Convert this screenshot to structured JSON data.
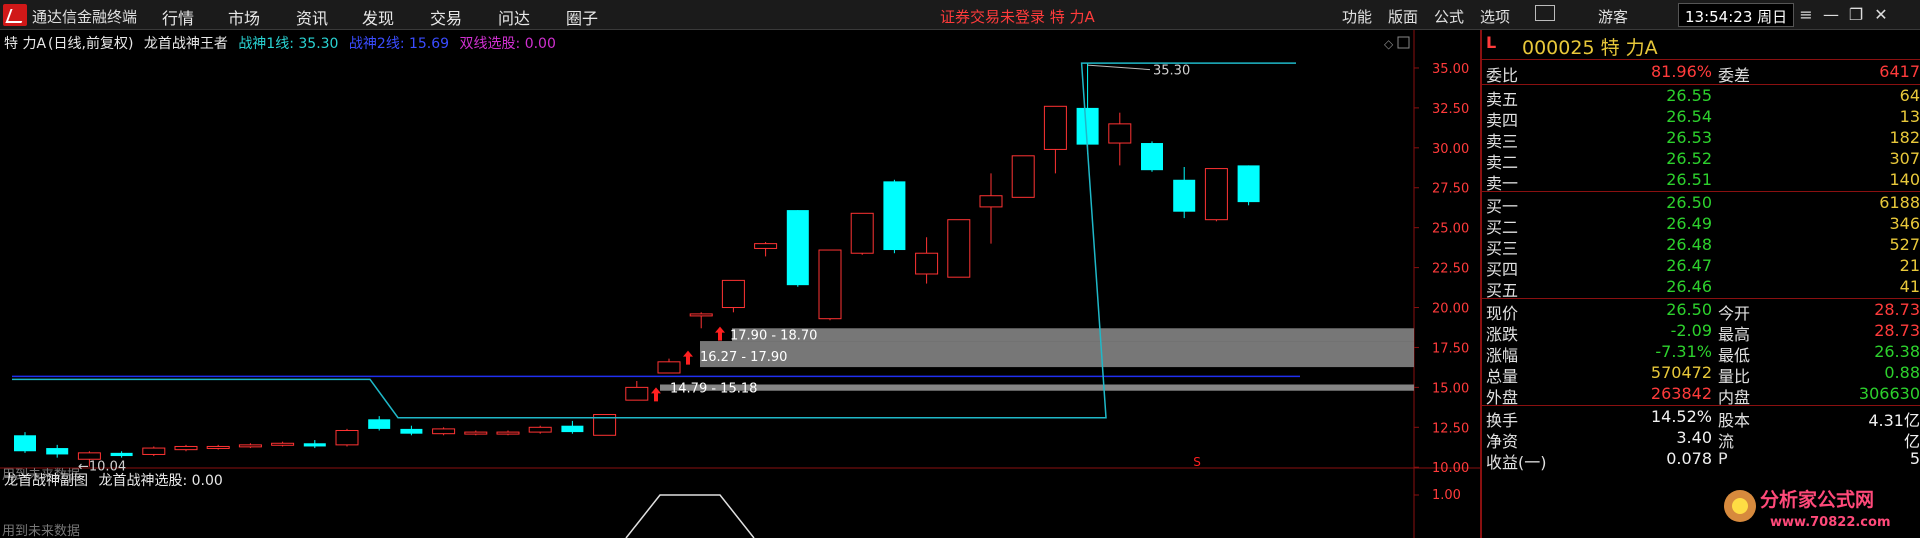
{
  "app": {
    "title": "通达信金融终端"
  },
  "menu": [
    "行情",
    "市场",
    "资讯",
    "发现",
    "交易",
    "问达",
    "圈子"
  ],
  "login_status": "证券交易未登录  特 力A",
  "right_menu": [
    "功能",
    "版面",
    "公式",
    "选项"
  ],
  "user": "游客",
  "clock": "13:54:23 周日",
  "chart": {
    "stock_label": "特 力A",
    "period_label": "(日线,前复权)",
    "indicator_name": "龙首战神王者",
    "line1_label": "战神1线: 35.30",
    "line2_label": "战神2线: 15.69",
    "select_label": "双线选股: 0.00",
    "sub_title": "龙首战神副图",
    "sub_select": "龙首战神选股: 0.00",
    "future_note_main": "用到未来数据",
    "future_note_sub": "用到未来数据",
    "low_label": "10.04",
    "high_label": "35.30",
    "zone_labels": [
      "17.90 - 18.70",
      "16.27 - 17.90",
      "14.79 - 15.18"
    ],
    "sub_value_label": "1.00",
    "s_marker": "S"
  },
  "chart_data": {
    "type": "candlestick",
    "y_ticks": [
      35.0,
      32.5,
      30.0,
      27.5,
      25.0,
      22.5,
      20.0,
      17.5,
      15.0,
      12.5,
      10.0
    ],
    "ylim": [
      9.2,
      36.0
    ],
    "candles": [
      {
        "o": 12.0,
        "c": 11.0,
        "h": 12.2,
        "l": 10.9,
        "up": false
      },
      {
        "o": 11.2,
        "c": 10.8,
        "h": 11.4,
        "l": 10.6,
        "up": false
      },
      {
        "o": 10.5,
        "c": 10.9,
        "h": 11.0,
        "l": 10.04,
        "up": true
      },
      {
        "o": 10.9,
        "c": 10.7,
        "h": 11.0,
        "l": 10.6,
        "up": false
      },
      {
        "o": 10.8,
        "c": 11.2,
        "h": 11.3,
        "l": 10.7,
        "up": true
      },
      {
        "o": 11.1,
        "c": 11.3,
        "h": 11.4,
        "l": 11.0,
        "up": true
      },
      {
        "o": 11.2,
        "c": 11.3,
        "h": 11.4,
        "l": 11.1,
        "up": true
      },
      {
        "o": 11.3,
        "c": 11.4,
        "h": 11.5,
        "l": 11.2,
        "up": true
      },
      {
        "o": 11.4,
        "c": 11.5,
        "h": 11.6,
        "l": 11.3,
        "up": true
      },
      {
        "o": 11.5,
        "c": 11.3,
        "h": 11.7,
        "l": 11.2,
        "up": false
      },
      {
        "o": 11.4,
        "c": 12.3,
        "h": 12.4,
        "l": 11.3,
        "up": true
      },
      {
        "o": 13.0,
        "c": 12.4,
        "h": 13.2,
        "l": 12.3,
        "up": false
      },
      {
        "o": 12.4,
        "c": 12.1,
        "h": 12.6,
        "l": 12.0,
        "up": false
      },
      {
        "o": 12.1,
        "c": 12.4,
        "h": 12.5,
        "l": 12.0,
        "up": true
      },
      {
        "o": 12.1,
        "c": 12.2,
        "h": 12.3,
        "l": 12.0,
        "up": true
      },
      {
        "o": 12.1,
        "c": 12.2,
        "h": 12.3,
        "l": 12.0,
        "up": true
      },
      {
        "o": 12.2,
        "c": 12.5,
        "h": 12.6,
        "l": 12.1,
        "up": true
      },
      {
        "o": 12.6,
        "c": 12.2,
        "h": 12.9,
        "l": 12.1,
        "up": false
      },
      {
        "o": 12.0,
        "c": 13.3,
        "h": 13.3,
        "l": 12.0,
        "up": true
      },
      {
        "o": 14.2,
        "c": 15.0,
        "h": 15.4,
        "l": 14.2,
        "up": true
      },
      {
        "o": 15.9,
        "c": 16.6,
        "h": 16.8,
        "l": 15.9,
        "up": true
      },
      {
        "o": 19.6,
        "c": 19.6,
        "h": 19.7,
        "l": 18.7,
        "up": true
      },
      {
        "o": 20.0,
        "c": 21.7,
        "h": 21.7,
        "l": 19.7,
        "up": true
      },
      {
        "o": 23.7,
        "c": 24.0,
        "h": 24.1,
        "l": 23.2,
        "up": true
      },
      {
        "o": 26.1,
        "c": 21.4,
        "h": 26.1,
        "l": 21.3,
        "up": false
      },
      {
        "o": 19.3,
        "c": 23.6,
        "h": 23.6,
        "l": 19.2,
        "up": true
      },
      {
        "o": 23.4,
        "c": 25.9,
        "h": 25.9,
        "l": 23.3,
        "up": true
      },
      {
        "o": 27.9,
        "c": 23.6,
        "h": 28.0,
        "l": 23.4,
        "up": false
      },
      {
        "o": 22.1,
        "c": 23.4,
        "h": 24.4,
        "l": 21.5,
        "up": true
      },
      {
        "o": 21.9,
        "c": 25.5,
        "h": 25.5,
        "l": 21.9,
        "up": true
      },
      {
        "o": 26.3,
        "c": 27.0,
        "h": 28.4,
        "l": 24.0,
        "up": true
      },
      {
        "o": 26.9,
        "c": 29.5,
        "h": 29.5,
        "l": 26.9,
        "up": true
      },
      {
        "o": 29.9,
        "c": 32.6,
        "h": 32.6,
        "l": 28.4,
        "up": true
      },
      {
        "o": 32.5,
        "c": 30.2,
        "h": 35.3,
        "l": 29.6,
        "up": false
      },
      {
        "o": 30.3,
        "c": 31.5,
        "h": 32.2,
        "l": 28.9,
        "up": true
      },
      {
        "o": 30.3,
        "c": 28.6,
        "h": 30.4,
        "l": 28.5,
        "up": false
      },
      {
        "o": 28.0,
        "c": 26.0,
        "h": 28.8,
        "l": 25.6,
        "up": false
      },
      {
        "o": 25.5,
        "c": 28.7,
        "h": 28.7,
        "l": 25.4,
        "up": true
      },
      {
        "o": 28.9,
        "c": 26.6,
        "h": 28.9,
        "l": 26.4,
        "up": false
      }
    ],
    "line1_level_low": 13.1,
    "line1_level_high": 35.3,
    "line2_level": 15.69,
    "zones": [
      {
        "low": 17.9,
        "high": 18.7
      },
      {
        "low": 16.27,
        "high": 17.9
      },
      {
        "low": 14.79,
        "high": 15.18
      }
    ]
  },
  "quote": {
    "tag": "L",
    "code_name": "000025 特 力A",
    "order_ratio_label": "委比",
    "order_ratio": "81.96%",
    "order_diff_label": "委差",
    "order_diff": "6417",
    "asks": [
      {
        "label": "卖五",
        "price": "26.55",
        "qty": "64"
      },
      {
        "label": "卖四",
        "price": "26.54",
        "qty": "13"
      },
      {
        "label": "卖三",
        "price": "26.53",
        "qty": "182"
      },
      {
        "label": "卖二",
        "price": "26.52",
        "qty": "307"
      },
      {
        "label": "卖一",
        "price": "26.51",
        "qty": "140"
      }
    ],
    "bids": [
      {
        "label": "买一",
        "price": "26.50",
        "qty": "6188"
      },
      {
        "label": "买二",
        "price": "26.49",
        "qty": "346"
      },
      {
        "label": "买三",
        "price": "26.48",
        "qty": "527"
      },
      {
        "label": "买四",
        "price": "26.47",
        "qty": "21"
      },
      {
        "label": "买五",
        "price": "26.46",
        "qty": "41"
      }
    ],
    "stats": [
      {
        "l": "现价",
        "v": "26.50",
        "vc": "green",
        "l2": "今开",
        "v2": "28.73",
        "v2c": "red"
      },
      {
        "l": "涨跌",
        "v": "-2.09",
        "vc": "green",
        "l2": "最高",
        "v2": "28.73",
        "v2c": "red"
      },
      {
        "l": "涨幅",
        "v": "-7.31%",
        "vc": "green",
        "l2": "最低",
        "v2": "26.38",
        "v2c": "green"
      },
      {
        "l": "总量",
        "v": "570472",
        "vc": "yellow",
        "l2": "量比",
        "v2": "0.88",
        "v2c": "green"
      },
      {
        "l": "外盘",
        "v": "263842",
        "vc": "red",
        "l2": "内盘",
        "v2": "306630",
        "v2c": "green"
      }
    ],
    "fin": [
      {
        "l": "换手",
        "v": "14.52%",
        "l2": "股本",
        "v2": "4.31亿"
      },
      {
        "l": "净资",
        "v": "3.40",
        "l2": "流",
        "v2": "亿"
      },
      {
        "l": "收益(一)",
        "v": "0.078",
        "l2": "P",
        "v2": "5"
      }
    ]
  },
  "watermark": {
    "title": "分析家公式网",
    "url": "www.70822.com"
  },
  "colors": {
    "up": "#ff3333",
    "down": "#00ffff",
    "line": "#1f7a8c",
    "blue": "#1f2ff0",
    "zone": "#8c8c8c"
  }
}
